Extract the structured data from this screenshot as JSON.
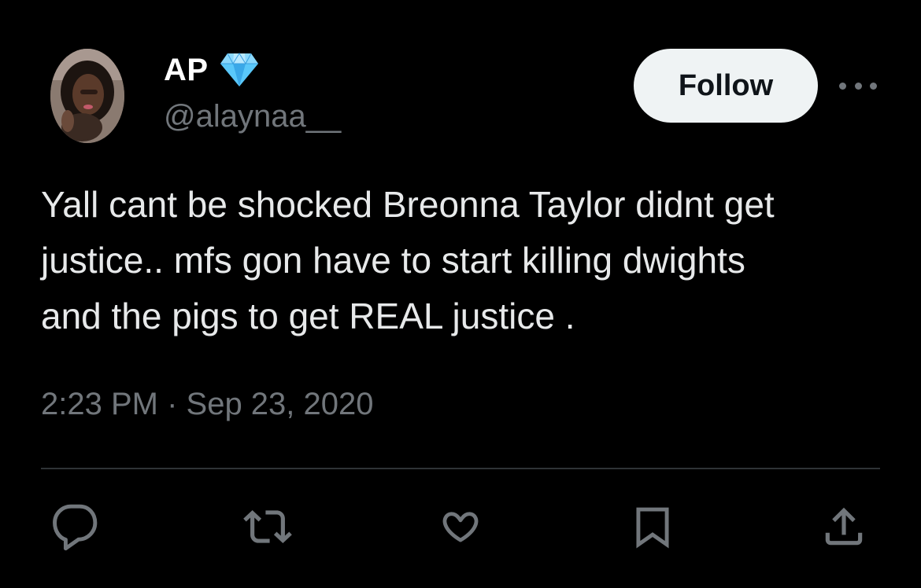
{
  "tweet": {
    "display_name": "AP",
    "handle": "@alaynaa__",
    "text": "Yall cant be shocked Breonna Taylor didnt get\njustice.. mfs gon have to start killing dwights\nand the pigs to get REAL justice .",
    "time": "2:23 PM",
    "separator": " · ",
    "date": "Sep 23, 2020"
  },
  "header": {
    "follow_label": "Follow",
    "more_icon": "more-horizontal-icon",
    "badge_icon": "diamond-emoji-icon"
  },
  "actions": [
    {
      "name": "reply",
      "icon": "reply-icon"
    },
    {
      "name": "retweet",
      "icon": "retweet-icon"
    },
    {
      "name": "like",
      "icon": "heart-icon"
    },
    {
      "name": "bookmark",
      "icon": "bookmark-icon"
    },
    {
      "name": "share",
      "icon": "share-icon"
    }
  ],
  "colors": {
    "background": "#000000",
    "text_primary": "#e7e9ea",
    "text_secondary": "#71767b",
    "follow_bg": "#eff3f4",
    "divider": "#2f3336",
    "diamond": "#5ac8fa"
  }
}
